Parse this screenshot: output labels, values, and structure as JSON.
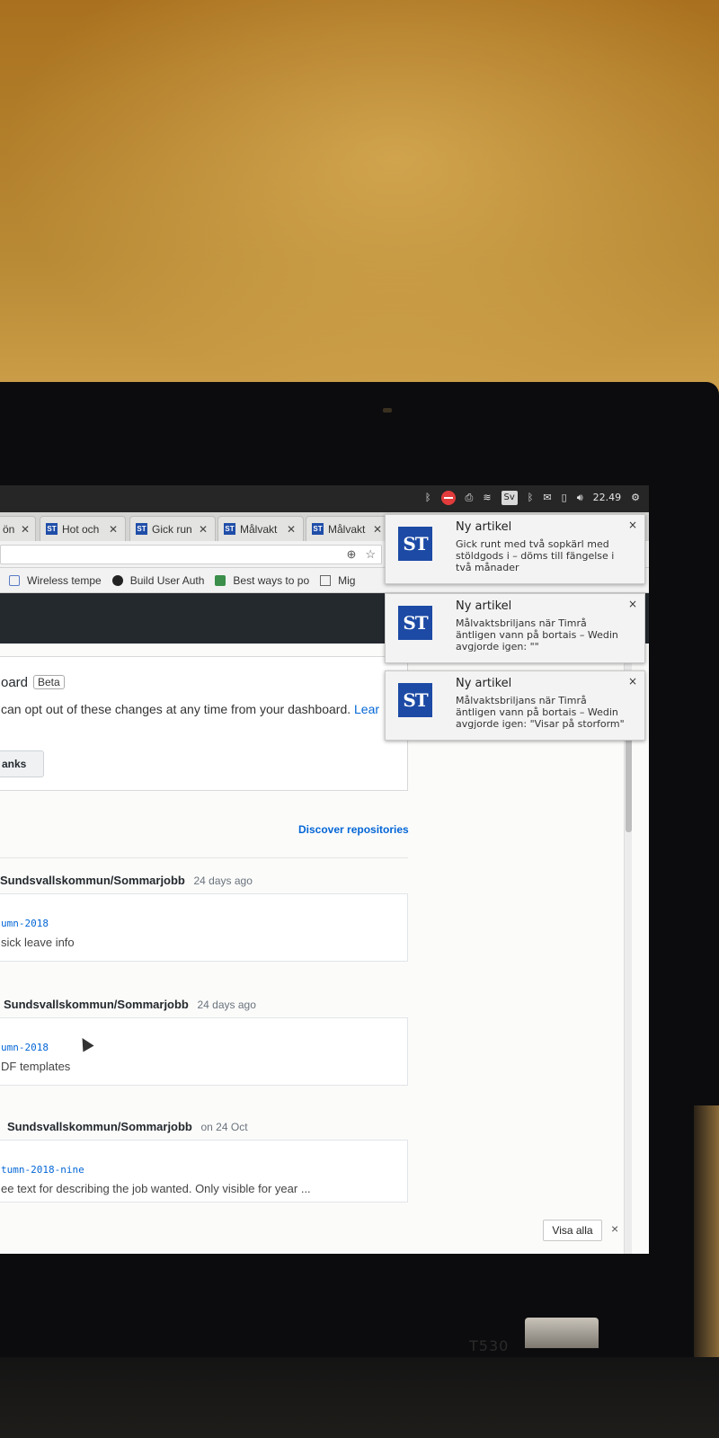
{
  "system_tray": {
    "keyboard_layout": "Sv",
    "clock": "22.49"
  },
  "tabs": [
    {
      "label": "ön",
      "favicon": "ST"
    },
    {
      "label": "Hot och",
      "favicon": "ST"
    },
    {
      "label": "Gick run",
      "favicon": "ST"
    },
    {
      "label": "Målvakt",
      "favicon": "ST"
    },
    {
      "label": "Målvakt",
      "favicon": "ST"
    }
  ],
  "bookmarks": [
    {
      "label": "Wireless tempe",
      "icon": "bookmark-icon"
    },
    {
      "label": "Build User Auth",
      "icon": "github-icon"
    },
    {
      "label": "Best ways to po",
      "icon": "site-icon"
    },
    {
      "label": "Mig",
      "icon": "page-icon"
    }
  ],
  "notice": {
    "title": "oard",
    "badge": "Beta",
    "text": "can opt out of these changes at any time from your dashboard.",
    "link": "Lear",
    "button": "anks"
  },
  "discover_link": "Discover repositories",
  "feed": [
    {
      "repo": "Sundsvallskommun/Sommarjobb",
      "time": "24 days ago",
      "branch": "umn-2018",
      "message": "sick leave info"
    },
    {
      "repo": "Sundsvallskommun/Sommarjobb",
      "time": "24 days ago",
      "branch": "umn-2018",
      "message": "DF templates"
    },
    {
      "repo": "Sundsvallskommun/Sommarjobb",
      "time": "on 24 Oct",
      "branch": "tumn-2018-nine",
      "message": "ee text for describing the job wanted. Only visible for year ..."
    }
  ],
  "notification_bar": {
    "show_all": "Visa alla",
    "close": "×"
  },
  "notifications": [
    {
      "logo": "ST",
      "title": "Ny artikel",
      "body": "Gick runt med två sopkärl med stöldgods i – döms till fängelse i två månader",
      "close": "×"
    },
    {
      "logo": "ST",
      "title": "Ny artikel",
      "body": "Målvaktsbriljans när Timrå äntligen vann på bortais – Wedin avgjorde igen: \"\"",
      "close": "×"
    },
    {
      "logo": "ST",
      "title": "Ny artikel",
      "body": "Målvaktsbriljans när Timrå äntligen vann på bortais – Wedin avgjorde igen: \"Visar på storform\"",
      "close": "×"
    }
  ],
  "device": {
    "model": "T530"
  }
}
